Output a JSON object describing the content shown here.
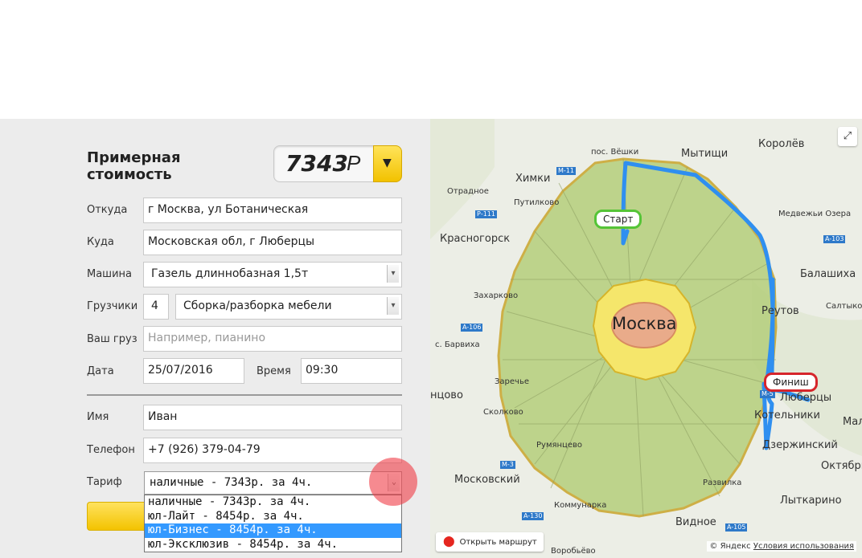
{
  "form": {
    "title": "Примерная стоимость",
    "price_value": "7343",
    "price_currency": "Р",
    "price_toggle_icon": "▼",
    "from": {
      "label": "Откуда",
      "value": "г Москва, ул Ботаническая"
    },
    "to": {
      "label": "Куда",
      "value": "Московская обл, г Люберцы"
    },
    "car": {
      "label": "Машина",
      "value": "Газель длиннобазная 1,5т"
    },
    "movers": {
      "label": "Грузчики",
      "count": "4",
      "service": "Сборка/разборка мебели"
    },
    "cargo": {
      "label": "Ваш груз",
      "placeholder": "Например, пианино"
    },
    "date": {
      "label": "Дата",
      "value": "25/07/2016"
    },
    "time": {
      "label": "Время",
      "value": "09:30"
    },
    "name": {
      "label": "Имя",
      "value": "Иван"
    },
    "phone": {
      "label": "Телефон",
      "value": "+7 (926) 379-04-79"
    },
    "tariff": {
      "label": "Тариф",
      "selected": "наличные - 7343р. за 4ч.",
      "options": [
        "наличные - 7343р. за 4ч.",
        "юл-Лайт - 8454р. за 4ч.",
        "юл-Бизнес - 8454р. за 4ч.",
        "юл-Эксклюзив - 8454р. за 4ч."
      ],
      "highlighted_index": 2
    }
  },
  "map": {
    "city": "Москва",
    "places": {
      "veshki": "пос. Вёшки",
      "mytishchi": "Мытищи",
      "korolev": "Королёв",
      "khimki": "Химки",
      "otradnoe": "Отрадное",
      "putilkovo": "Путилково",
      "medvezhi": "Медвежьи Озера",
      "krasnogorsk": "Красногорск",
      "balashikha": "Балашиха",
      "zakharkovo": "Захарково",
      "reutov": "Реутов",
      "saltykovka": "Салтыко",
      "barvikha": "с. Барвиха",
      "zarechye": "Заречье",
      "lyubertsy": "Люберцы",
      "odintsovo": "нцово",
      "kotelniki": "Котельники",
      "skolkovo": "Сколково",
      "rumyantsevo": "Румянцево",
      "dzerzhinsky": "Дзержинский",
      "oktyabr": "Октябрь",
      "moskovsky": "Московский",
      "razvilka": "Развилка",
      "kommunarka": "Коммунарка",
      "lytkarino": "Лыткарино",
      "vidnoe": "Видное",
      "mal": "Мал",
      "vorobyovo": "Воробьёво"
    },
    "highways": {
      "m11": "М-11",
      "r111": "Р-111",
      "a103": "A-103",
      "a106": "A-106",
      "m5": "М-5",
      "m3": "М-3",
      "a130": "A-130",
      "a105": "A-105"
    },
    "start_label": "Старт",
    "finish_label": "Финиш",
    "expand_icon": "⤢",
    "route_pin_icon": "⬤",
    "route_button": "Открыть маршрут",
    "copyright_prefix": "© Яндекс",
    "terms_link": "Условия использования"
  },
  "colors": {
    "accent_yellow": "#f3c300",
    "route_blue": "#2f8ff0",
    "start_green": "#55c437",
    "finish_red": "#d6252b"
  }
}
